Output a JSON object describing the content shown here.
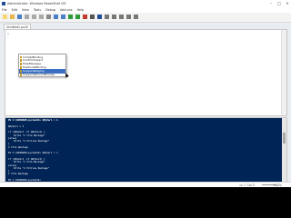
{
  "window": {
    "title": "Administrator: Windows PowerShell ISE",
    "min_glyph": "–",
    "max_glyph": "□",
    "close_glyph": "×"
  },
  "menu": [
    "File",
    "Edit",
    "View",
    "Tools",
    "Debug",
    "Add-ons",
    "Help"
  ],
  "toolbar": {
    "icons": [
      "new-icon",
      "open-icon",
      "save-icon",
      "cut-icon",
      "copy-icon",
      "paste-icon",
      "clear-icon",
      "undo-icon",
      "redo-icon",
      "run-icon",
      "run-selection-icon",
      "stop-icon",
      "remote-icon",
      "powershell-icon",
      "layout-icon",
      "pane-icon",
      "pane2-icon",
      "show-script-icon",
      "show-command-icon"
    ]
  },
  "tabs": [
    {
      "label": "Untitled1.ps1*",
      "close": "×"
    }
  ],
  "editor": {
    "line_number": "1"
  },
  "autocomplete": {
    "items": [
      {
        "label": "CmdletBinding"
      },
      {
        "label": "ConfirmImpact"
      },
      {
        "label": "HelpMessage"
      },
      {
        "label": "PositionalBinding"
      },
      {
        "label": "SupportsPaging"
      },
      {
        "label": "SupportsShouldProcess"
      }
    ],
    "selected_index": 4
  },
  "console": {
    "lines": [
      {
        "text": "PS C:\\WINDOWS\\system32> $MyVar1 = 1",
        "hdr": true
      },
      {
        "text": "",
        "hdr": false
      },
      {
        "text": "$MyVar1 = 1",
        "hdr": false
      },
      {
        "text": "",
        "hdr": false
      },
      {
        "text": "if ($MyVar1 -lt $MyVar2) {",
        "hdr": false
      },
      {
        "text": "    Write \"1 Tite Nachage\"",
        "hdr": false
      },
      {
        "text": "}else{",
        "hdr": false
      },
      {
        "text": "    Write \"2 Vitiles Nachage\"",
        "hdr": false
      },
      {
        "text": "}",
        "hdr": false
      },
      {
        "text": "2 Tite Nachage",
        "hdr": false
      },
      {
        "text": "",
        "hdr": false
      },
      {
        "text": "PS C:\\WINDOWS\\system32> $MyVar1 = 1",
        "hdr": false
      },
      {
        "text": "",
        "hdr": false
      },
      {
        "text": "if ($MyVar1 -lt $MyVar2) {",
        "hdr": false
      },
      {
        "text": "    Write \"1 Tite Nachage\"",
        "hdr": false
      },
      {
        "text": "}else{",
        "hdr": false
      },
      {
        "text": "    Write \"2 Vitiles Nachage\"",
        "hdr": false
      },
      {
        "text": "}",
        "hdr": false
      },
      {
        "text": "1 Tite Nachage",
        "hdr": false
      },
      {
        "text": "",
        "hdr": false
      },
      {
        "text": "PS C:\\WINDOWS\\system32>",
        "hdr": false
      }
    ]
  },
  "status": {
    "position": "Ln 7 Col 5",
    "zoom": "100%"
  },
  "colors": {
    "console_bg": "#012456",
    "selection": "#3a6fc4"
  }
}
